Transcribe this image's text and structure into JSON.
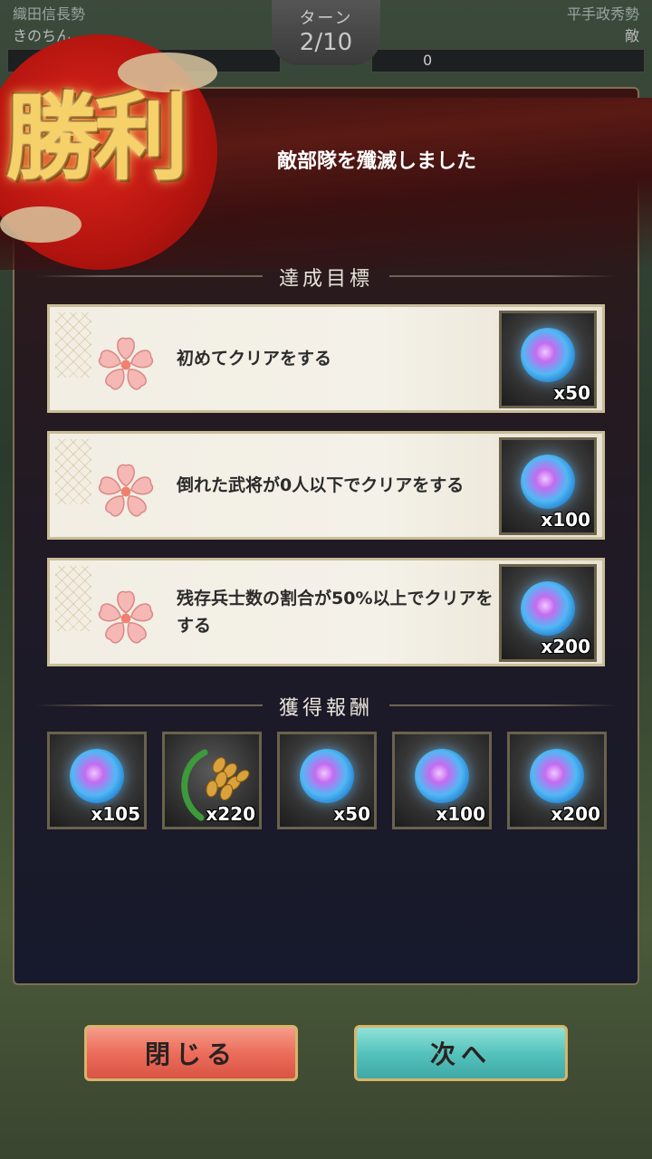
{
  "header": {
    "left_faction": "織田信長勢",
    "right_faction": "平手政秀勢",
    "left_player": "きのちん",
    "right_player": "敵",
    "turn_label": "ターン",
    "turn_value": "2/10",
    "enemy_hp": "0"
  },
  "result": {
    "victory_text": "勝利",
    "message": "敵部隊を殲滅しました"
  },
  "objectives": {
    "title": "達成目標",
    "items": [
      {
        "text": "初めてクリアをする",
        "reward_icon": "spirit-orb-icon",
        "reward_qty": "x50"
      },
      {
        "text": "倒れた武将が0人以下でクリアをする",
        "reward_icon": "spirit-orb-icon",
        "reward_qty": "x100"
      },
      {
        "text": "残存兵士数の割合が50%以上でクリアをする",
        "reward_icon": "spirit-orb-icon",
        "reward_qty": "x200"
      }
    ]
  },
  "rewards": {
    "title": "獲得報酬",
    "items": [
      {
        "icon": "spirit-orb-icon",
        "qty": "x105"
      },
      {
        "icon": "rice-icon",
        "qty": "x220"
      },
      {
        "icon": "spirit-orb-icon",
        "qty": "x50"
      },
      {
        "icon": "spirit-orb-icon",
        "qty": "x100"
      },
      {
        "icon": "spirit-orb-icon",
        "qty": "x200"
      }
    ]
  },
  "buttons": {
    "close": "閉じる",
    "next": "次へ"
  },
  "colors": {
    "victory_gold": "#f6d16a",
    "sun_red": "#c41a12",
    "close_button": "#ec6d5b",
    "next_button": "#55c3bd"
  }
}
